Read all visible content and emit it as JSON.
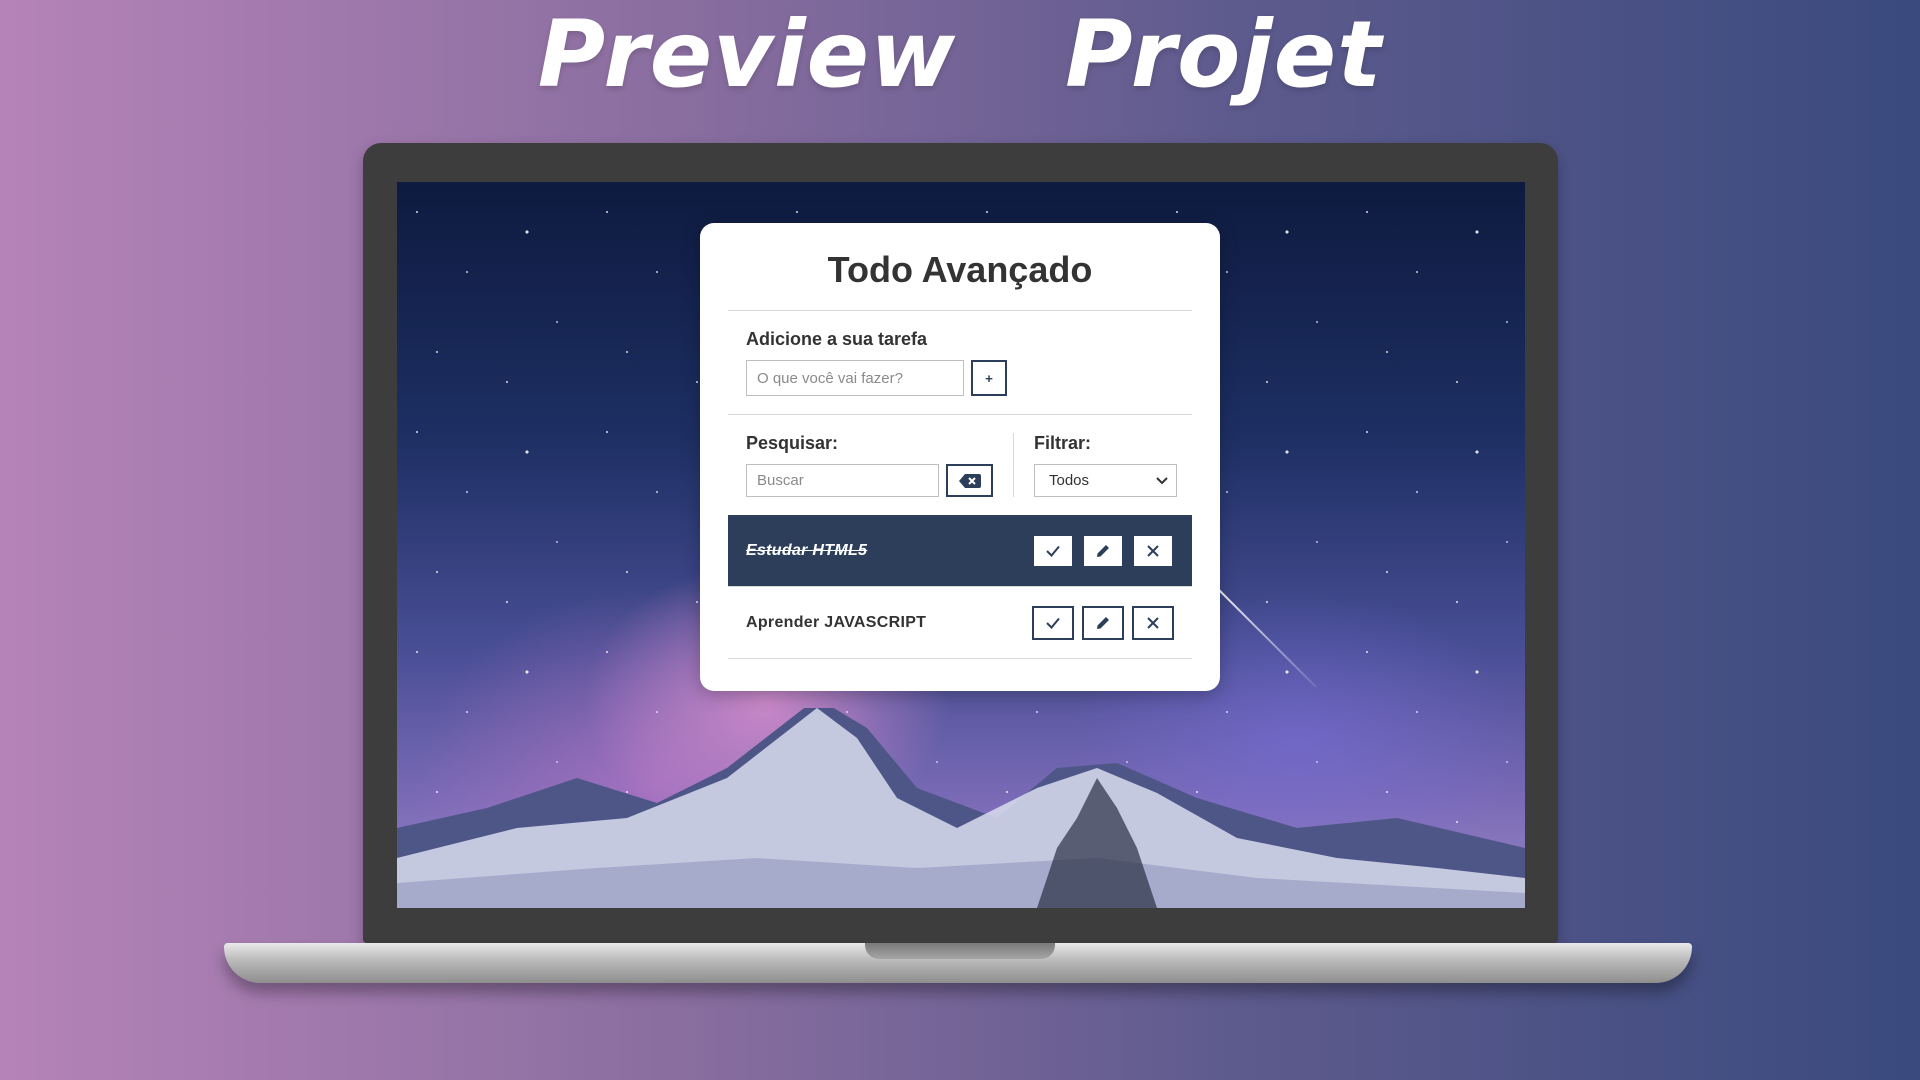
{
  "headline": {
    "word1": "Preview",
    "word2": "Projet"
  },
  "app": {
    "title": "Todo Avançado",
    "add": {
      "label": "Adicione a sua tarefa",
      "placeholder": "O que você vai fazer?",
      "button": "+"
    },
    "search": {
      "label": "Pesquisar:",
      "placeholder": "Buscar",
      "clear_icon": "backspace-icon"
    },
    "filter": {
      "label": "Filtrar:",
      "selected": "Todos"
    },
    "todos": [
      {
        "text": "Estudar HTML5",
        "done": true
      },
      {
        "text": "Aprender JAVASCRIPT",
        "done": false
      }
    ],
    "colors": {
      "primary": "#2c3e5a",
      "card_bg": "#ffffff"
    }
  }
}
